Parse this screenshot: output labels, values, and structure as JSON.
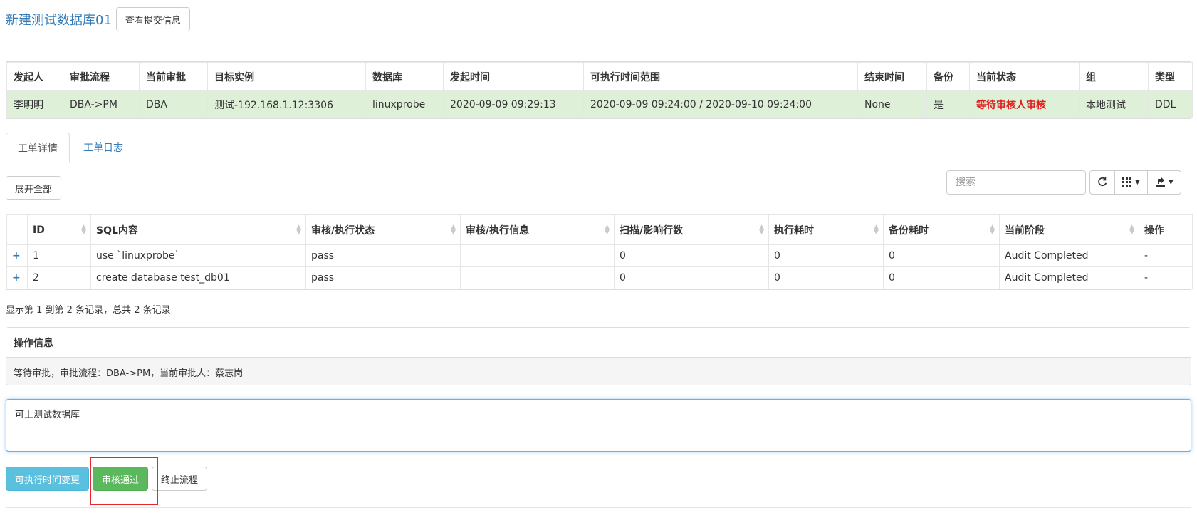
{
  "header": {
    "title": "新建测试数据库01",
    "view_submit_label": "查看提交信息"
  },
  "summary": {
    "columns": [
      "发起人",
      "审批流程",
      "当前审批",
      "目标实例",
      "数据库",
      "发起时间",
      "可执行时间范围",
      "结束时间",
      "备份",
      "当前状态",
      "组",
      "类型"
    ],
    "row": [
      "李明明",
      "DBA->PM",
      "DBA",
      "测试-192.168.1.12:3306",
      "linuxprobe",
      "2020-09-09 09:29:13",
      "2020-09-09 09:24:00 / 2020-09-10 09:24:00",
      "None",
      "是",
      "等待审核人审核",
      "本地测试",
      "DDL"
    ]
  },
  "tabs": [
    {
      "label": "工单详情",
      "active": true
    },
    {
      "label": "工单日志",
      "active": false
    }
  ],
  "toolbar": {
    "expand_all_label": "展开全部",
    "search_placeholder": "搜索",
    "refresh_icon": "refresh-icon",
    "columns_icon": "columns-icon",
    "export_icon": "export-icon"
  },
  "detail": {
    "columns": [
      "",
      "ID",
      "SQL内容",
      "审核/执行状态",
      "审核/执行信息",
      "扫描/影响行数",
      "执行耗时",
      "备份耗时",
      "当前阶段",
      "操作"
    ],
    "rows": [
      [
        "+",
        "1",
        "use `linuxprobe`",
        "pass",
        "",
        "0",
        "0",
        "0",
        "Audit Completed",
        "-"
      ],
      [
        "+",
        "2",
        "create database test_db01",
        "pass",
        "",
        "0",
        "0",
        "0",
        "Audit Completed",
        "-"
      ]
    ]
  },
  "records_text": "显示第 1 到第 2 条记录，总共 2 条记录",
  "operation_panel": {
    "heading": "操作信息",
    "body": "等待审批，审批流程：DBA->PM，当前审批人：蔡志岗"
  },
  "remark": {
    "value": "可上测试数据库"
  },
  "actions": {
    "change_time_label": "可执行时间变更",
    "approve_label": "审核通过",
    "stop_label": "终止流程"
  },
  "colors": {
    "link_blue": "#337ab7",
    "success_row": "#dff0d8",
    "status_red": "#e11d1d",
    "info": "#5bc0de",
    "success": "#5cb85c",
    "highlight": "#e8252a"
  }
}
